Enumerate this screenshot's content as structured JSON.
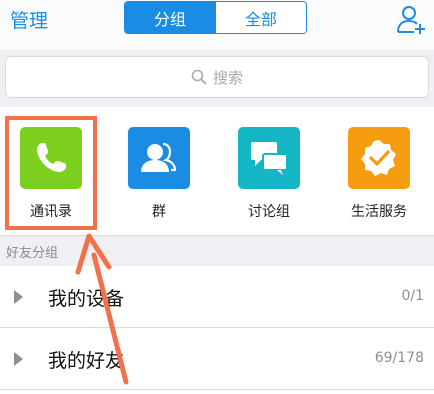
{
  "header": {
    "manage_label": "管理",
    "tabs": [
      {
        "label": "分组",
        "active": true
      },
      {
        "label": "全部",
        "active": false
      }
    ],
    "add_icon": "add-user-icon"
  },
  "search": {
    "placeholder": "搜索",
    "icon": "search-icon"
  },
  "apps": [
    {
      "label": "通讯录",
      "icon": "phone-icon",
      "color": "#7ccf1e"
    },
    {
      "label": "群",
      "icon": "group-icon",
      "color": "#1a8ce3"
    },
    {
      "label": "讨论组",
      "icon": "chat-bubbles-icon",
      "color": "#14b6c6"
    },
    {
      "label": "生活服务",
      "icon": "service-badge-icon",
      "color": "#f59d0e"
    }
  ],
  "friends_section": {
    "title": "好友分组",
    "groups": [
      {
        "name": "我的设备",
        "count": "0/1"
      },
      {
        "name": "我的好友",
        "count": "69/178"
      }
    ]
  },
  "colors": {
    "accent": "#1a8ce3",
    "highlight": "#f0714b"
  }
}
